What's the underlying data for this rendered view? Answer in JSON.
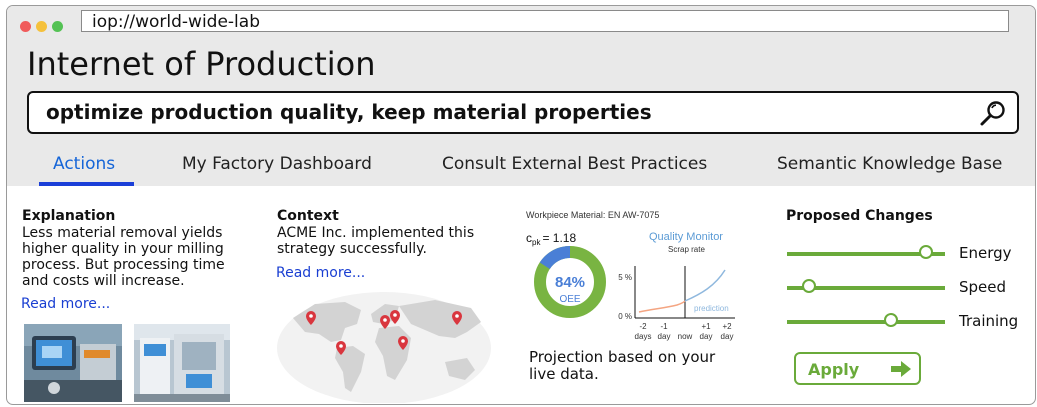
{
  "browser": {
    "url": "iop://world-wide-lab",
    "dot_colors": [
      "#f05b5b",
      "#f5c13c",
      "#54c254"
    ]
  },
  "app": {
    "title": "Internet of Production",
    "search_query": "optimize production quality, keep material properties"
  },
  "tabs": [
    {
      "label": "Actions",
      "active": true
    },
    {
      "label": "My Factory Dashboard",
      "active": false
    },
    {
      "label": "Consult External Best Practices",
      "active": false
    },
    {
      "label": "Semantic Knowledge Base",
      "active": false
    }
  ],
  "explanation": {
    "title": "Explanation",
    "lines": [
      "Less material removal yields",
      "higher quality in your milling",
      "process. But processing time",
      "and costs will increase."
    ],
    "read_more": "Read more..."
  },
  "context": {
    "title": "Context",
    "lines": [
      "ACME Inc. implemented this",
      "strategy successfully."
    ],
    "read_more": "Read more..."
  },
  "quality": {
    "material": "Workpiece Material: EN AW-7075",
    "cpk_label": "c",
    "cpk_sub": "pk",
    "cpk_value": "= 1.18",
    "monitor_title": "Quality Monitor",
    "scrap_label": "Scrap rate",
    "oee_value": "84%",
    "oee_label": "OEE",
    "oee_fraction": 0.84,
    "y_tick_top": "5 %",
    "y_tick_bottom": "0 %",
    "x_ticks": [
      {
        "top": "-2",
        "bottom": "days"
      },
      {
        "top": "-1",
        "bottom": "day"
      },
      {
        "top": "",
        "bottom": "now"
      },
      {
        "top": "+1",
        "bottom": "day"
      },
      {
        "top": "+2",
        "bottom": "day"
      }
    ],
    "prediction_label": "prediction",
    "caption_lines": [
      "Projection based on your",
      "live data."
    ],
    "colors": {
      "accent": "#5b9bd5",
      "oee_green": "#79b442",
      "oee_blue": "#4a7fd6",
      "history": "#f4a582"
    }
  },
  "proposed": {
    "title": "Proposed Changes",
    "sliders": [
      {
        "label": "Energy",
        "value": 0.88
      },
      {
        "label": "Speed",
        "value": 0.14
      },
      {
        "label": "Training",
        "value": 0.66
      }
    ],
    "apply_label": "Apply",
    "accent": "#6aaa3a"
  }
}
